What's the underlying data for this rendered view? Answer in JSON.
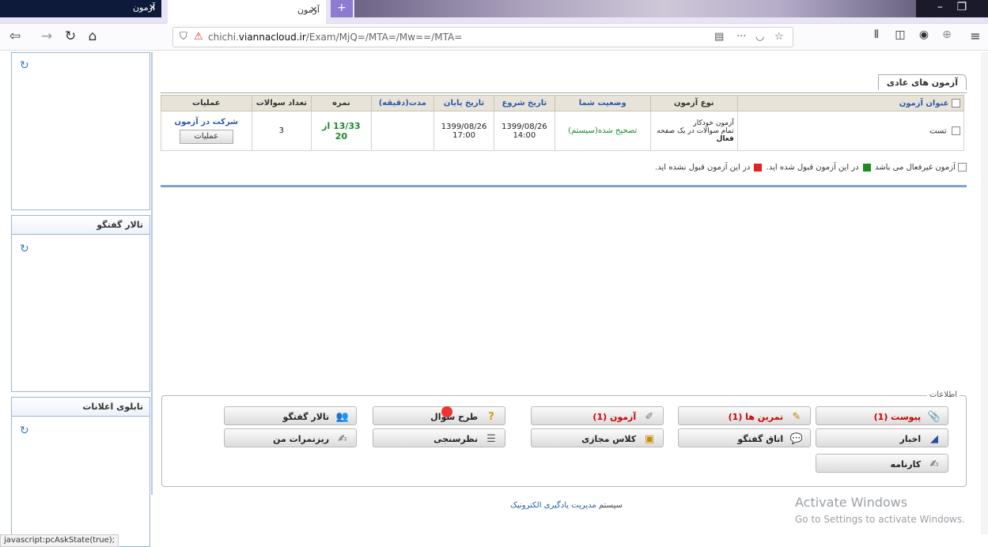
{
  "browser": {
    "tab_inactive_label": "آزمون",
    "tab_active_label": "آزمون",
    "url_domain": "chichi.",
    "url_host": "viannacloud.ir",
    "url_path": "/Exam/MjQ=/MTA=/Mw==/MTA=",
    "status_text": "javascript:pcAskState(true);"
  },
  "sidebar": {
    "panel2_title": "تالار گفتگو",
    "panel3_title": "تابلوی اعلانات"
  },
  "exams": {
    "section_title": "آزمون های عادی",
    "columns": [
      "عنوان آزمون",
      "نوع آزمون",
      "وضعیت شما",
      "تاریخ شروع",
      "تاریخ پایان",
      "مدت(دقیقه)",
      "نمره",
      "تعداد سوالات",
      "عملیات"
    ],
    "row": {
      "title": "تست",
      "type_line1": "آزمون خودکار",
      "type_line2": "تمام سوالات در یک صفحه",
      "type_line3": "فعال",
      "status": "تصحیح شده(سیستم)",
      "start_date": "1399/08/26",
      "start_time": "14:00",
      "end_date": "1399/08/26",
      "end_time": "17:00",
      "duration": "",
      "grade": "13/33 از 20",
      "question_count": "3",
      "take_exam_link": "شرکت در آزمون",
      "operations_button": "عملیات"
    },
    "legend_inactive": "آزمون غیرفعال می باشد",
    "legend_accepted": "در این آزمون قبول شده اید.",
    "legend_failed": "در این آزمون قبول نشده اید."
  },
  "info": {
    "label": "اطلاعات",
    "buttons": {
      "attachment": "پیوست (1)",
      "exercises": "تمرین ها (1)",
      "exam": "آزمون (1)",
      "question_design": "طرح سوال",
      "forum": "تالار گفتگو",
      "news": "اخبار",
      "chat_room": "اتاق گفتگو",
      "virtual_class": "کلاس مجازی",
      "survey": "نظرسنجی",
      "my_grades": "ریزنمرات من",
      "report_card": "کارنامه"
    }
  },
  "footer": {
    "prefix": "سیستم",
    "link": "مدیریت یادگیری الکترونیک"
  },
  "watermark": {
    "line1": "Activate Windows",
    "line2": "Go to Settings to activate Windows."
  },
  "colors": {
    "accepted": "#1f8a1f",
    "failed": "#e52222",
    "link": "#2a5aa8"
  }
}
